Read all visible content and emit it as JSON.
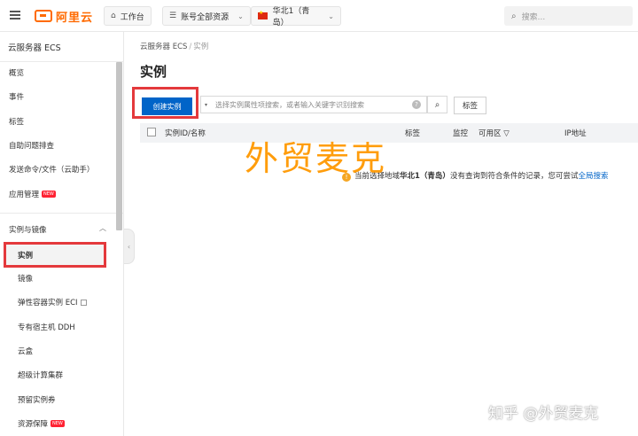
{
  "header": {
    "logo_text": "阿里云",
    "workbench_label": "工作台",
    "account_label": "账号全部资源",
    "region_label": "华北1（青岛）",
    "search_placeholder": "搜索..."
  },
  "sidebar": {
    "title": "云服务器 ECS",
    "items": [
      {
        "label": "概览"
      },
      {
        "label": "事件"
      },
      {
        "label": "标签"
      },
      {
        "label": "自助问题排查"
      },
      {
        "label": "发送命令/文件（云助手）"
      },
      {
        "label": "应用管理",
        "badge": "NEW"
      }
    ],
    "group_label": "实例与镜像",
    "sub_items": [
      {
        "label": "实例",
        "active": true
      },
      {
        "label": "镜像"
      },
      {
        "label": "弹性容器实例 ECI"
      },
      {
        "label": "专有宿主机 DDH"
      },
      {
        "label": "云盒"
      },
      {
        "label": "超级计算集群"
      },
      {
        "label": "预留实例券"
      },
      {
        "label": "资源保障",
        "badge": "NEW"
      }
    ]
  },
  "main": {
    "breadcrumb": [
      "云服务器 ECS",
      "实例"
    ],
    "breadcrumb_sep": "/",
    "title": "实例",
    "create_button": "创建实例",
    "filter_placeholder": "选择实例属性项搜索，或者输入关键字识别搜索",
    "tag_button": "标签",
    "columns": [
      "实例ID/名称",
      "标签",
      "监控",
      "可用区",
      "IP地址"
    ],
    "empty_prefix": "当前选择地域",
    "empty_region": "华北1（青岛）",
    "empty_middle": "没有查询到符合条件的记录，您可尝试",
    "empty_link": "全局搜索"
  },
  "overlay": {
    "watermark": "外贸麦克",
    "credit": "知乎 @外贸麦克"
  },
  "colors": {
    "brand": "#ff6a00",
    "primary": "#0064c8",
    "highlight": "#e4393c",
    "watermark": "#ff9800"
  }
}
